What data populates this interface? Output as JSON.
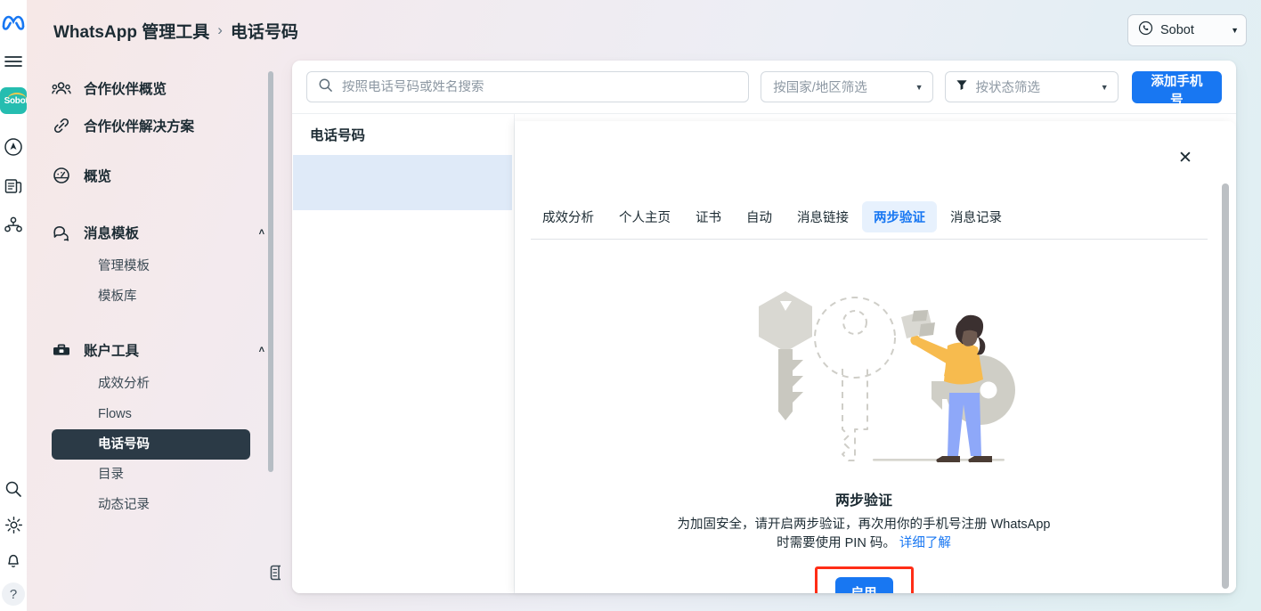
{
  "rail": {
    "icons": [
      {
        "name": "meta-logo-icon",
        "label": "Meta"
      },
      {
        "name": "hamburger-menu-icon",
        "label": "菜单"
      },
      {
        "name": "sobot-logo-badge",
        "label": "Sobot"
      },
      {
        "name": "ads-manager-icon",
        "label": "广告管理"
      },
      {
        "name": "pages-icon",
        "label": "主页"
      },
      {
        "name": "business-icon",
        "label": "商务"
      },
      {
        "name": "search-icon",
        "label": "搜索"
      },
      {
        "name": "gear-icon",
        "label": "设置"
      },
      {
        "name": "bell-icon",
        "label": "通知"
      },
      {
        "name": "help-icon",
        "label": "?"
      }
    ],
    "sobot_badge_text": "Sobot",
    "help_glyph": "?"
  },
  "header": {
    "breadcrumb_root": "WhatsApp 管理工具",
    "breadcrumb_separator": "›",
    "breadcrumb_current": "电话号码",
    "account_name": "Sobot",
    "account_caret": "▼"
  },
  "sidebar": {
    "items": [
      {
        "label": "合作伙伴概览",
        "icon": "people-icon",
        "type": "item"
      },
      {
        "label": "合作伙伴解决方案",
        "icon": "link-icon",
        "type": "item"
      },
      {
        "label": "概览",
        "icon": "gauge-icon",
        "type": "item"
      },
      {
        "label": "消息模板",
        "icon": "chat-bubbles-icon",
        "type": "group",
        "chevron": "˄"
      },
      {
        "label": "管理模板",
        "type": "sub"
      },
      {
        "label": "模板库",
        "type": "sub"
      },
      {
        "label": "账户工具",
        "icon": "toolbox-icon",
        "type": "group",
        "chevron": "˄"
      },
      {
        "label": "成效分析",
        "type": "sub"
      },
      {
        "label": "Flows",
        "type": "sub"
      },
      {
        "label": "电话号码",
        "type": "sub",
        "active": true
      },
      {
        "label": "目录",
        "type": "sub"
      },
      {
        "label": "动态记录",
        "type": "sub"
      }
    ],
    "collapse_icon": "panel-collapse-icon"
  },
  "toolbar": {
    "search_placeholder": "按照电话号码或姓名搜索",
    "search_value": "",
    "country_filter_label": "按国家/地区筛选",
    "status_filter_label": "按状态筛选",
    "add_phone_label": "添加手机号",
    "caret": "▼"
  },
  "list_panel": {
    "header": "电话号码",
    "rows": [
      {
        "label": "",
        "selected": true
      }
    ]
  },
  "detail": {
    "close_glyph": "✕",
    "tabs": [
      {
        "label": "成效分析",
        "active": false
      },
      {
        "label": "个人主页",
        "active": false
      },
      {
        "label": "证书",
        "active": false
      },
      {
        "label": "自动",
        "active": false
      },
      {
        "label": "消息链接",
        "active": false
      },
      {
        "label": "两步验证",
        "active": true
      },
      {
        "label": "消息记录",
        "active": false
      }
    ],
    "title": "两步验证",
    "description_line1": "为加固安全，请开启两步验证，再次用你的手机号注册",
    "description_line2": "WhatsApp 时需要使用 PIN 码。",
    "learn_more": "详细了解",
    "enable_button": "启用",
    "illustration_name": "two-keys-and-person-illustration"
  },
  "colors": {
    "primary_blue": "#1877f2",
    "tab_active_bg": "#e7f1fd",
    "annotation_red": "#ff2d16",
    "sidebar_active_bg": "#2b3a46",
    "list_selected_bg": "#dfeaf8",
    "sobot_teal": "#25bdb0"
  }
}
